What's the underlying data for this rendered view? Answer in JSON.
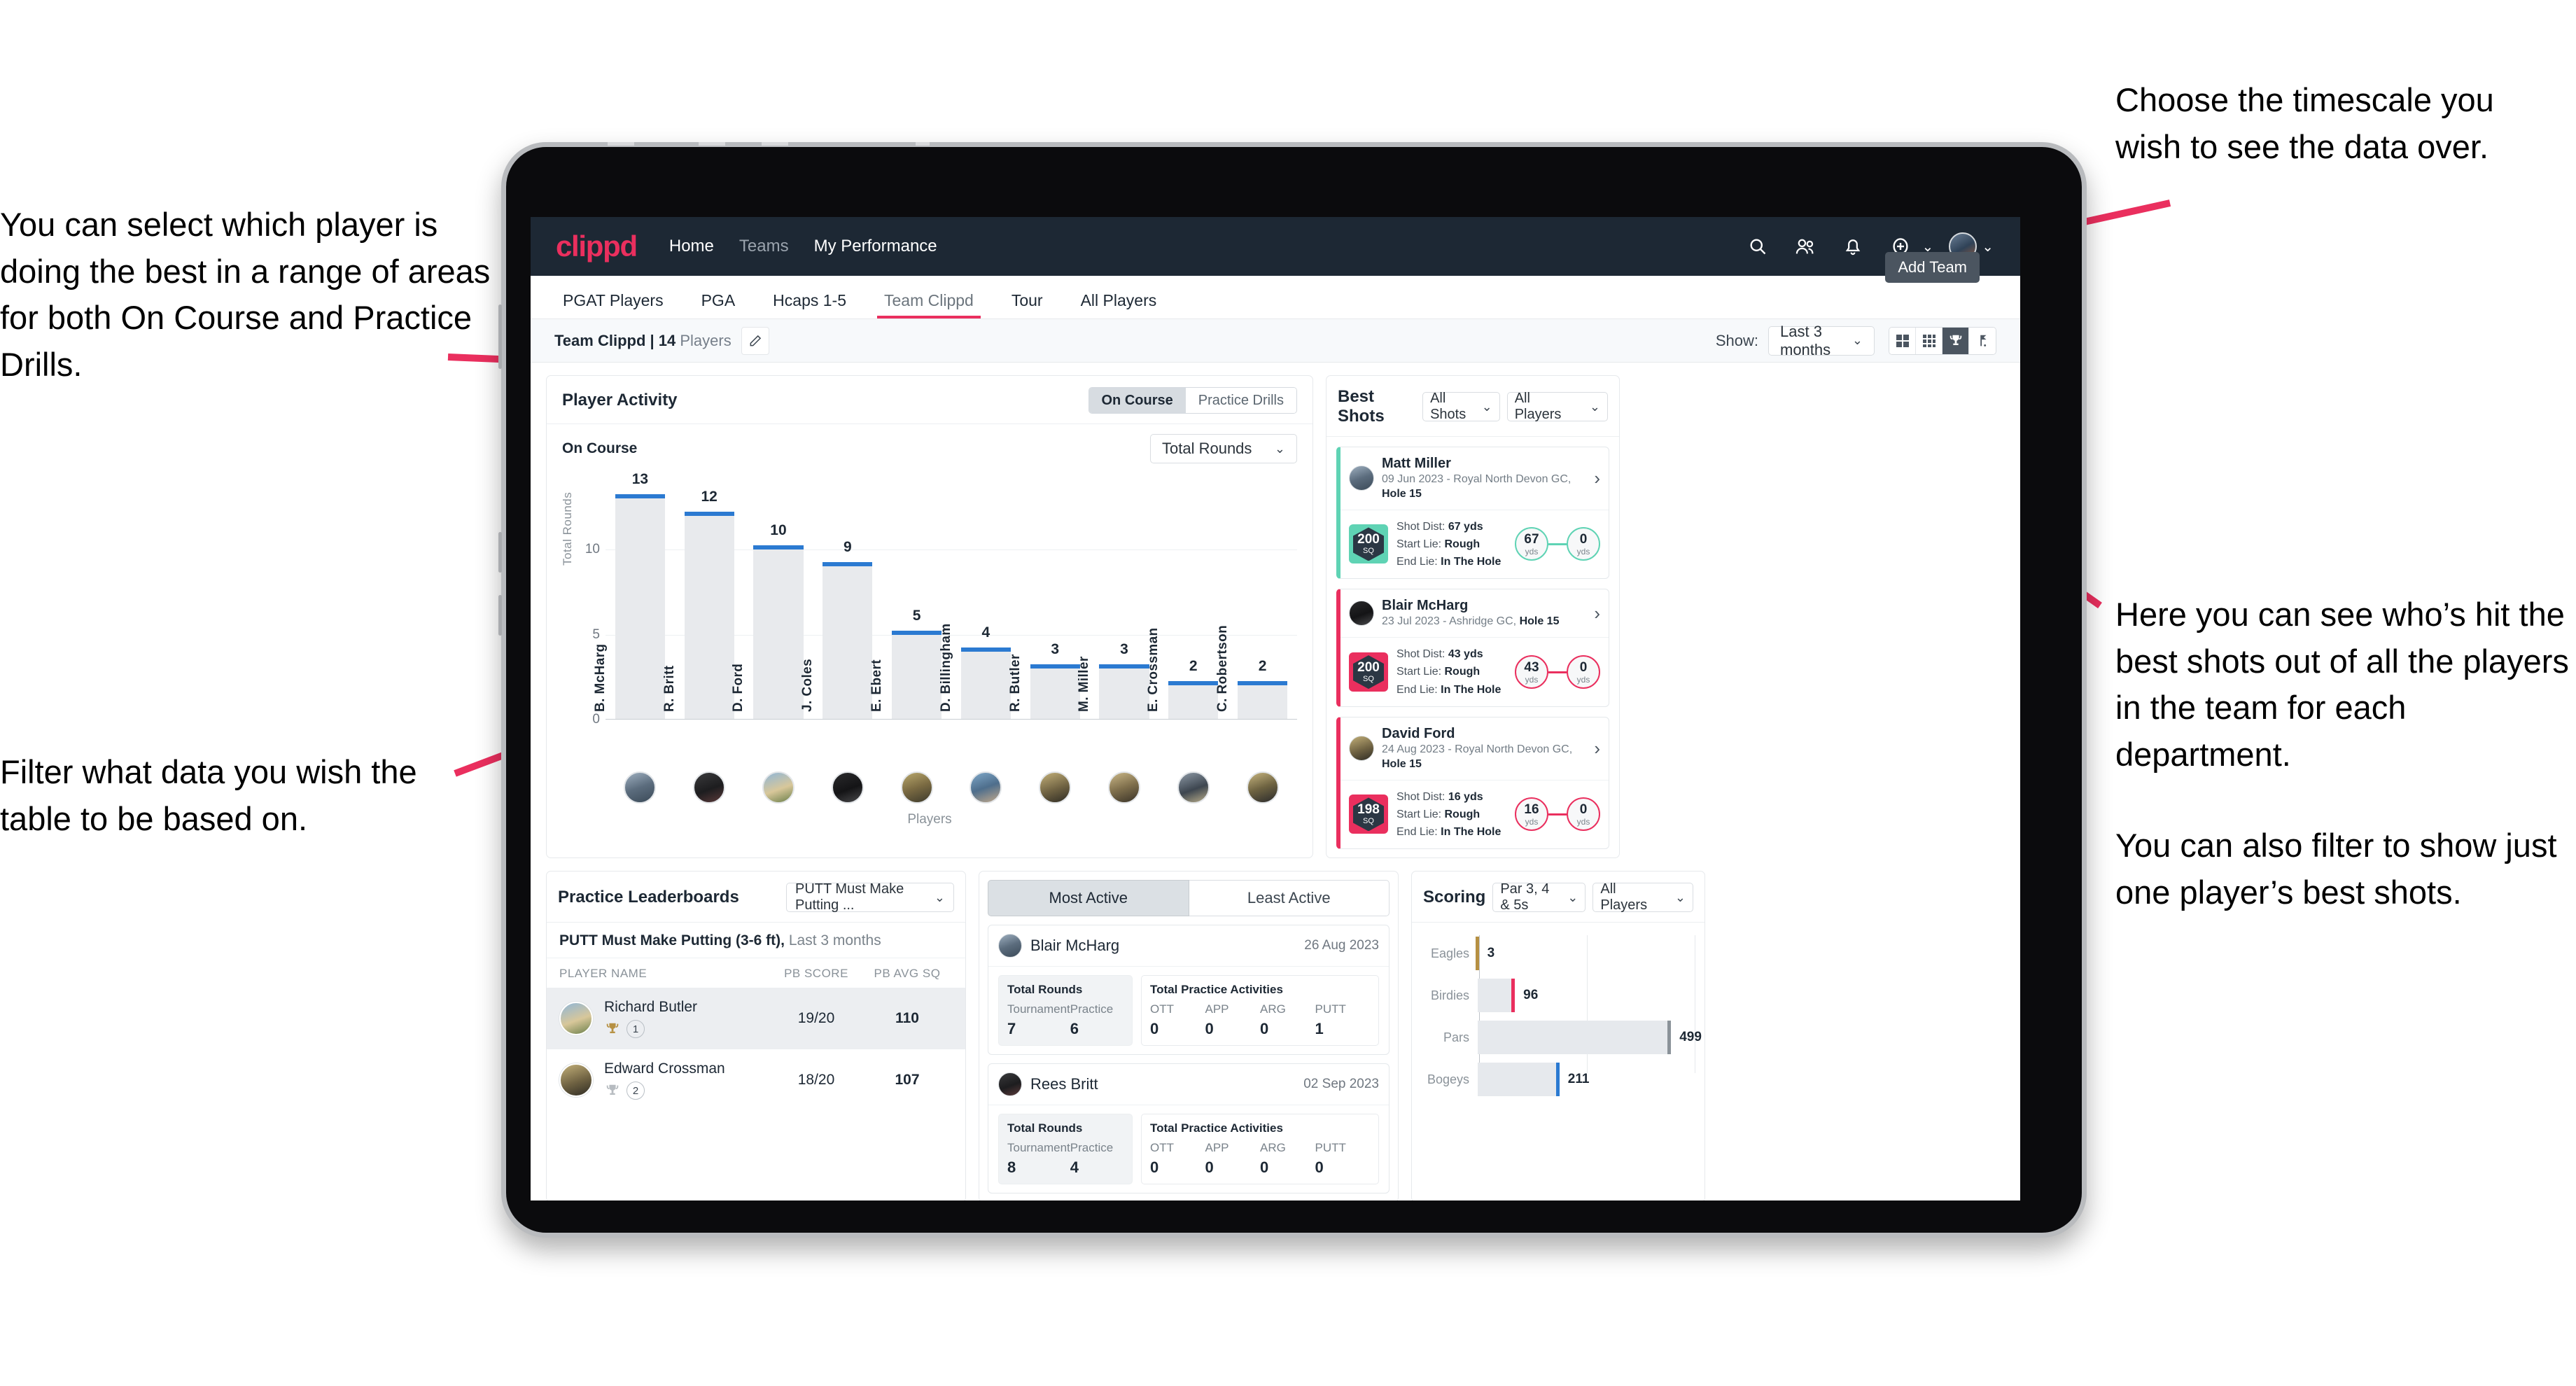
{
  "annotations": {
    "left_top": "You can select which player is doing the best in a range of areas for both On Course and Practice Drills.",
    "left_bottom": "Filter what data you wish the table to be based on.",
    "right_top": "Choose the timescale you wish to see the data over.",
    "right_middle": "Here you can see who’s hit the best shots out of all the players in the team for each department.",
    "right_bottom": "You can also filter to show just one player’s best shots."
  },
  "app": {
    "logo": "clippd",
    "nav_links": [
      {
        "label": "Home",
        "dim": false
      },
      {
        "label": "Teams",
        "dim": true
      },
      {
        "label": "My Performance",
        "dim": false
      }
    ],
    "icons": [
      "search-icon",
      "team-icon",
      "bell-icon",
      "plus-circle-icon",
      "avatar"
    ],
    "tooltip_add_team": "Add Team"
  },
  "tabs": [
    {
      "label": "PGAT Players",
      "active": false
    },
    {
      "label": "PGA",
      "active": false
    },
    {
      "label": "Hcaps 1-5",
      "active": false
    },
    {
      "label": "Team Clippd",
      "active": true
    },
    {
      "label": "Tour",
      "active": false
    },
    {
      "label": "All Players",
      "active": false
    }
  ],
  "subbar": {
    "team_title_bold": "Team Clippd | 14",
    "team_title_light": " Players",
    "show_label": "Show:",
    "show_value": "Last 3 months",
    "view_buttons": [
      "grid-large-icon",
      "grid-small-icon",
      "trophy-icon",
      "flag-icon"
    ],
    "view_selected_index": 2
  },
  "player_activity": {
    "title": "Player Activity",
    "segments": [
      {
        "label": "On Course",
        "active": true
      },
      {
        "label": "Practice Drills",
        "active": false
      }
    ],
    "sub_label": "On Course",
    "metric_select": "Total Rounds"
  },
  "chart_data": [
    {
      "type": "bar",
      "title": "Player Activity – On Course",
      "xlabel": "Players",
      "ylabel": "Total Rounds",
      "categories": [
        "B. McHarg",
        "R. Britt",
        "D. Ford",
        "J. Coles",
        "E. Ebert",
        "D. Billingham",
        "R. Butler",
        "M. Miller",
        "E. Crossman",
        "C. Robertson"
      ],
      "values": [
        13,
        12,
        10,
        9,
        5,
        4,
        3,
        3,
        2,
        2
      ],
      "yticks": [
        0,
        5,
        10
      ],
      "ylim": [
        0,
        14
      ],
      "grid": true,
      "bar_color": "#e8eaed",
      "cap_color": "#2b7ad1"
    },
    {
      "type": "bar",
      "orientation": "horizontal",
      "title": "Scoring",
      "categories": [
        "Eagles",
        "Birdies",
        "Pars",
        "Bogeys"
      ],
      "values": [
        3,
        96,
        499,
        211
      ],
      "cap_colors": [
        "#b69042",
        "#ea2f5e",
        "#8a9299",
        "#2b7ad1"
      ],
      "xlim": [
        0,
        560
      ],
      "grid": true
    }
  ],
  "best_shots": {
    "title": "Best Shots",
    "shots_filter": "All Shots",
    "players_filter": "All Players",
    "cards": [
      {
        "name": "Matt Miller",
        "meta_prefix": "09 Jun 2023 - Royal North Devon GC, ",
        "meta_bold": "Hole 15",
        "badge_value": "200",
        "badge_unit": "SQ",
        "badge_color": "#5fd3b4",
        "accent": "#5fd3b4",
        "shot_dist_label": "Shot Dist: ",
        "shot_dist_value": "67 yds",
        "start_lie_label": "Start Lie: ",
        "start_lie_value": "Rough",
        "end_lie_label": "End Lie: ",
        "end_lie_value": "In The Hole",
        "from_value": "67",
        "from_unit": "yds",
        "to_value": "0",
        "to_unit": "yds"
      },
      {
        "name": "Blair McHarg",
        "meta_prefix": "23 Jul 2023 - Ashridge GC, ",
        "meta_bold": "Hole 15",
        "badge_value": "200",
        "badge_unit": "SQ",
        "badge_color": "#ea2f5e",
        "accent": "#ea2f5e",
        "shot_dist_label": "Shot Dist: ",
        "shot_dist_value": "43 yds",
        "start_lie_label": "Start Lie: ",
        "start_lie_value": "Rough",
        "end_lie_label": "End Lie: ",
        "end_lie_value": "In The Hole",
        "from_value": "43",
        "from_unit": "yds",
        "to_value": "0",
        "to_unit": "yds"
      },
      {
        "name": "David Ford",
        "meta_prefix": "24 Aug 2023 - Royal North Devon GC, ",
        "meta_bold": "Hole 15",
        "badge_value": "198",
        "badge_unit": "SQ",
        "badge_color": "#ea2f5e",
        "accent": "#ea2f5e",
        "shot_dist_label": "Shot Dist: ",
        "shot_dist_value": "16 yds",
        "start_lie_label": "Start Lie: ",
        "start_lie_value": "Rough",
        "end_lie_label": "End Lie: ",
        "end_lie_value": "In The Hole",
        "from_value": "16",
        "from_unit": "yds",
        "to_value": "0",
        "to_unit": "yds"
      }
    ]
  },
  "practice_leaderboards": {
    "title": "Practice Leaderboards",
    "drill_select": "PUTT Must Make Putting ...",
    "subtitle_bold": "PUTT Must Make Putting (3-6 ft),",
    "subtitle_light": " Last 3 months",
    "columns": [
      "PLAYER NAME",
      "PB SCORE",
      "PB AVG SQ"
    ],
    "rows": [
      {
        "name": "Richard Butler",
        "rank": "1",
        "trophy": "gold",
        "pb_score": "19/20",
        "pb_avg_sq": "110",
        "highlight": true
      },
      {
        "name": "Edward Crossman",
        "rank": "2",
        "trophy": "silver",
        "pb_score": "18/20",
        "pb_avg_sq": "107",
        "highlight": false
      }
    ]
  },
  "activity": {
    "tabs": [
      {
        "label": "Most Active",
        "active": true
      },
      {
        "label": "Least Active",
        "active": false
      }
    ],
    "items": [
      {
        "name": "Blair McHarg",
        "date": "26 Aug 2023",
        "rounds_title": "Total Rounds",
        "rounds_keys": [
          "Tournament",
          "Practice"
        ],
        "rounds_values": [
          "7",
          "6"
        ],
        "practice_title": "Total Practice Activities",
        "practice_keys": [
          "OTT",
          "APP",
          "ARG",
          "PUTT"
        ],
        "practice_values": [
          "0",
          "0",
          "0",
          "1"
        ]
      },
      {
        "name": "Rees Britt",
        "date": "02 Sep 2023",
        "rounds_title": "Total Rounds",
        "rounds_keys": [
          "Tournament",
          "Practice"
        ],
        "rounds_values": [
          "8",
          "4"
        ],
        "practice_title": "Total Practice Activities",
        "practice_keys": [
          "OTT",
          "APP",
          "ARG",
          "PUTT"
        ],
        "practice_values": [
          "0",
          "0",
          "0",
          "0"
        ]
      }
    ]
  },
  "scoring": {
    "title": "Scoring",
    "par_filter": "Par 3, 4 & 5s",
    "players_filter": "All Players"
  },
  "colors": {
    "brand_pink": "#ea2f5e",
    "nav_dark": "#1d2834",
    "bar_blue": "#2b7ad1",
    "teal": "#5fd3b4",
    "gold": "#b69042"
  }
}
